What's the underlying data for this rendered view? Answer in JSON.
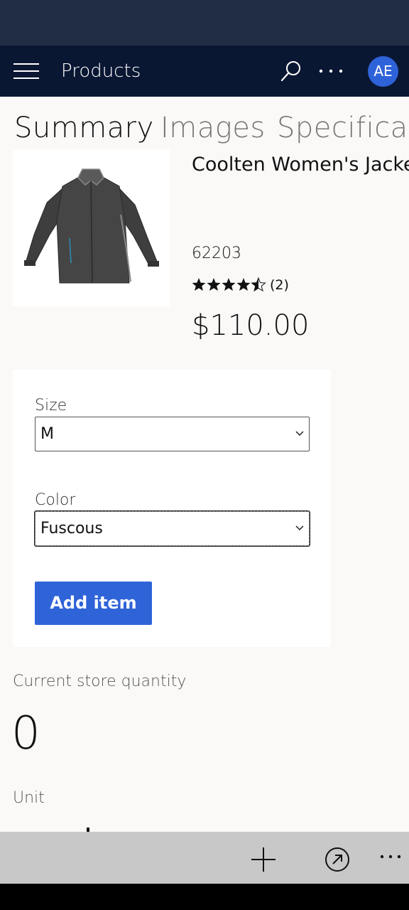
{
  "app_bar": {
    "title": "Products",
    "avatar_initials": "AE",
    "icons": {
      "menu": "hamburger-menu-icon",
      "search": "search-icon",
      "more": "more-ellipsis-icon"
    }
  },
  "tabs": [
    {
      "label": "Summary",
      "active": true
    },
    {
      "label": "Images",
      "active": false
    },
    {
      "label": "Specification",
      "active": false
    }
  ],
  "product": {
    "name": "Coolten Women's Jacket",
    "id": "62203",
    "rating_value": 4.5,
    "rating_count": "(2)",
    "price": "$110.00",
    "image_icon": "jacket-image"
  },
  "config": {
    "size_label": "Size",
    "size_value": "M",
    "color_label": "Color",
    "color_value": "Fuscous",
    "add_button": "Add item"
  },
  "store": {
    "qty_label": "Current store quantity",
    "qty_value": "0",
    "unit_label": "Unit"
  },
  "bottom_bar": {
    "icons": {
      "add": "plus-icon",
      "open": "open-arrow-icon",
      "more": "more-ellipsis-icon"
    }
  },
  "colors": {
    "status_bar": "#202d44",
    "app_bar": "#0a1733",
    "accent": "#2f63d8",
    "avatar": "#2e62d9",
    "bottom_bar": "#c8c8c8"
  }
}
